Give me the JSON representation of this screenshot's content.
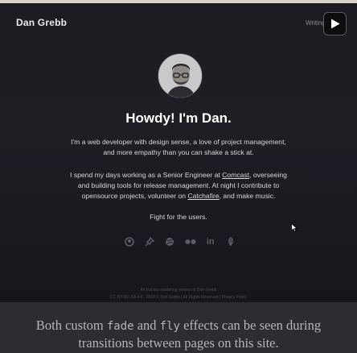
{
  "header": {
    "brand": "Dan Grebb",
    "nav_writing": "Writing",
    "play_icon": "play-icon"
  },
  "hero": {
    "avatar_alt": "avatar",
    "headline": "Howdy! I'm Dan."
  },
  "intro": {
    "p1_line1": "I'm a web developer with design sense, a love of project management,",
    "p1_line2": "and more empathy than you can shake a stick at.",
    "p2_a": "I spend my days working as a Senior Engineer at ",
    "p2_link_comcast": "Comcast",
    "p2_b": ", overseeing",
    "p2_line2": "and building tools for release management. At night I contribute to",
    "p2_c": "opensource projects, volunteer on ",
    "p2_link_catchafire": "Catchafire",
    "p2_d": ", and make music.",
    "p3": "Fight for the users."
  },
  "social": [
    "github-icon",
    "pin-icon",
    "dribbble-icon",
    "flickr-icon",
    "linkedin-icon",
    "feather-icon"
  ],
  "social_linkedin_text": "in",
  "footer": {
    "line1": "All text the rendering version of Dan Grebb",
    "line2": "CC BY-NC-SA 4.0 · 2023 © Dan Grebb | All Rights Reserved | Privacy Policy"
  },
  "caption": {
    "line1_a": "Both custom ",
    "line1_code1": "fade",
    "line1_b": " and ",
    "line1_code2": "fly",
    "line1_c": " effects can be seen during",
    "line2": "transitions between pages on this site."
  },
  "colors": {
    "background": "#1c1c22",
    "text": "#d6d6da",
    "muted_icon": "#5e5e66",
    "caption_bg": "#2c2d33"
  }
}
